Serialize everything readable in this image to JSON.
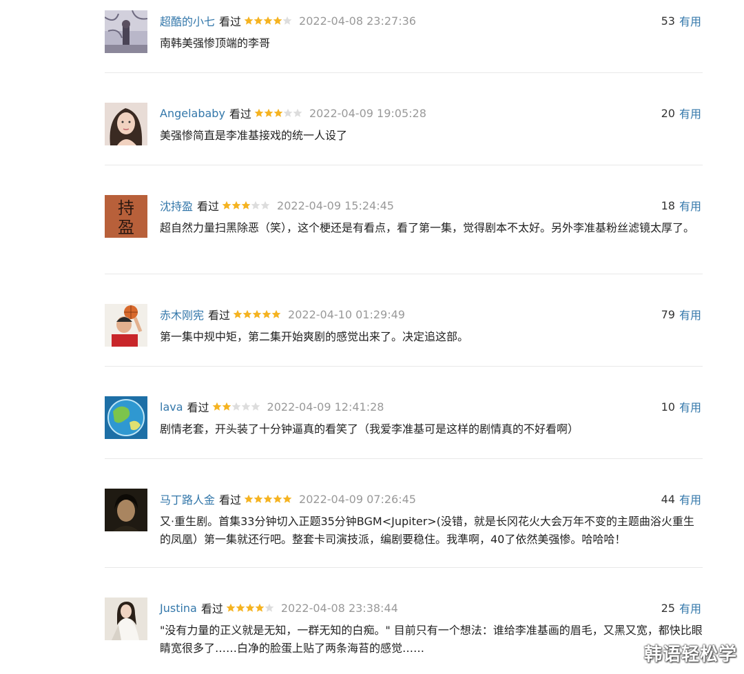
{
  "colors": {
    "link": "#3377aa",
    "meta": "#999999",
    "star_on": "#f5b321",
    "star_off": "#dddddd"
  },
  "comments": [
    {
      "user": "超酷的小七",
      "status": "看过",
      "rating": 4,
      "time": "2022-04-08 23:27:36",
      "votes": "53",
      "useful": "有用",
      "text": "南韩美强惨顶端的李哥",
      "avatar_icon": "tree-portrait-avatar"
    },
    {
      "user": "Angelababy",
      "status": "看过",
      "rating": 3,
      "time": "2022-04-09 19:05:28",
      "votes": "20",
      "useful": "有用",
      "text": "美强惨简直是李准基接戏的统一人设了",
      "avatar_icon": "woman-portrait-avatar"
    },
    {
      "user": "沈持盈",
      "status": "看过",
      "rating": 3,
      "time": "2022-04-09 15:24:45",
      "votes": "18",
      "useful": "有用",
      "text": "超自然力量扫黑除恶（笑），这个梗还是有看点，看了第一集，觉得剧本不太好。另外李准基粉丝滤镜太厚了。",
      "avatar_icon": "calligraphy-avatar",
      "avatar_text": "持盈"
    },
    {
      "user": "赤木刚宪",
      "status": "看过",
      "rating": 5,
      "time": "2022-04-10 01:29:49",
      "votes": "79",
      "useful": "有用",
      "text": "第一集中规中矩，第二集开始爽剧的感觉出来了。决定追这部。",
      "avatar_icon": "basketball-player-avatar"
    },
    {
      "user": "lava",
      "status": "看过",
      "rating": 2,
      "time": "2022-04-09 12:41:28",
      "votes": "10",
      "useful": "有用",
      "text": "剧情老套，开头装了十分钟逼真的看笑了（我爱李准基可是这样的剧情真的不好看啊）",
      "avatar_icon": "earth-globe-avatar"
    },
    {
      "user": "马丁路人金",
      "status": "看过",
      "rating": 5,
      "time": "2022-04-09 07:26:45",
      "votes": "44",
      "useful": "有用",
      "text": "又·重生剧。首集33分钟切入正题35分钟BGM<Jupiter>(没错，就是长冈花火大会万年不变的主题曲浴火重生的凤凰）第一集就还行吧。整套卡司演技派，编剧要稳住。我準啊，40了依然美强惨。哈哈哈！",
      "avatar_icon": "man-portrait-avatar"
    },
    {
      "user": "Justina",
      "status": "看过",
      "rating": 4,
      "time": "2022-04-08 23:38:44",
      "votes": "25",
      "useful": "有用",
      "text": "\"没有力量的正义就是无知，一群无知的白痴。\" 目前只有一个想法：谁给李准基画的眉毛，又黑又宽，都快比眼睛宽很多了……白净的脸蛋上贴了两条海苔的感觉……",
      "avatar_icon": "woman-white-dress-avatar"
    }
  ],
  "watermark": "韩语轻松学"
}
